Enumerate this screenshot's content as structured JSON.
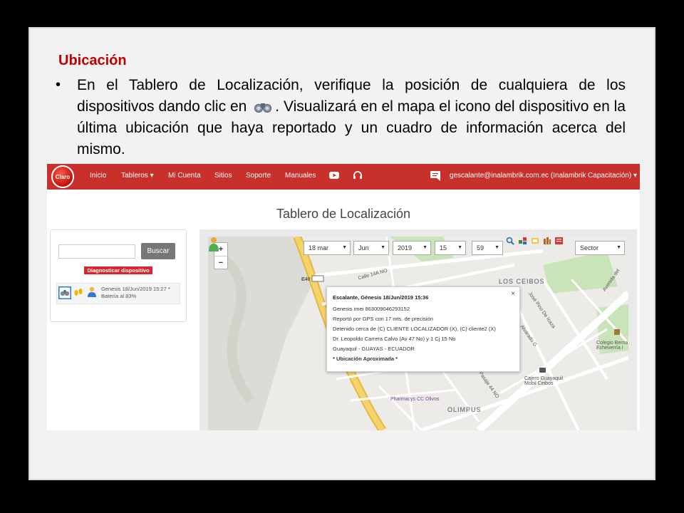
{
  "slide": {
    "title": "Ubicación",
    "bullet_part1": "En el Tablero de Localización, verifique la posición de cualquiera de los dispositivos dando clic en",
    "bullet_part2": ". Visualizará en el mapa el icono del dispositivo en la última ubicación que haya reportado y un cuadro de información acerca del mismo."
  },
  "app": {
    "logo_text": "Claro",
    "nav": [
      "Inicio",
      "Tableros ▾",
      "Mi Cuenta",
      "Sitios",
      "Soporte",
      "Manuales"
    ],
    "user": "gescalante@inalambrik.com.ec (Inalambrik Capacitación) ▾",
    "page_title": "Tablero de Localización"
  },
  "side": {
    "search_button": "Buscar",
    "diag_button": "Diagnosticar dispositivo",
    "device_line1": "Genesis 18/Jun/2019 15:27 *",
    "device_line2": "Batería al 83%"
  },
  "map": {
    "date": "18 mar",
    "month": "Jun",
    "year": "2019",
    "hour": "15",
    "minute": "59",
    "layer": "Sector",
    "places": {
      "los_ceibos": "LOS CEIBOS",
      "olimpus": "OLIMPUS",
      "pharmacys": "Pharmacys CC Olivos",
      "cajero": "Cajero Guayaquil Mobil Ceibos",
      "colegio": "Colegio Berna Echeverría I",
      "e40": "E40",
      "calle14a": "Calle 14A NO",
      "jose_pino": "José Pino De Icaza",
      "alvarado": "Alvarado G",
      "pasaje": "Pasaje 44 NO",
      "avenida": "Avenida del"
    },
    "popup": {
      "title": "Escalante, Génesis 18/Jun/2019 15:36",
      "imei": "Genesis imei 863009046293152",
      "gps": "Reportó por GPS con 17 mts. de precisión",
      "detenido": "Detenido cerca de (C) CLIENTE LOCALIZADOR (X), (C) cliente2 (X)",
      "dir": "Dr. Leopoldo Carrera Calvo (Av 47 No) y 1 Cj 15 No",
      "city": "Guayaquil - GUAYAS - ECUADOR",
      "approx": "* Ubicación Aproximada *",
      "close": "×"
    }
  }
}
